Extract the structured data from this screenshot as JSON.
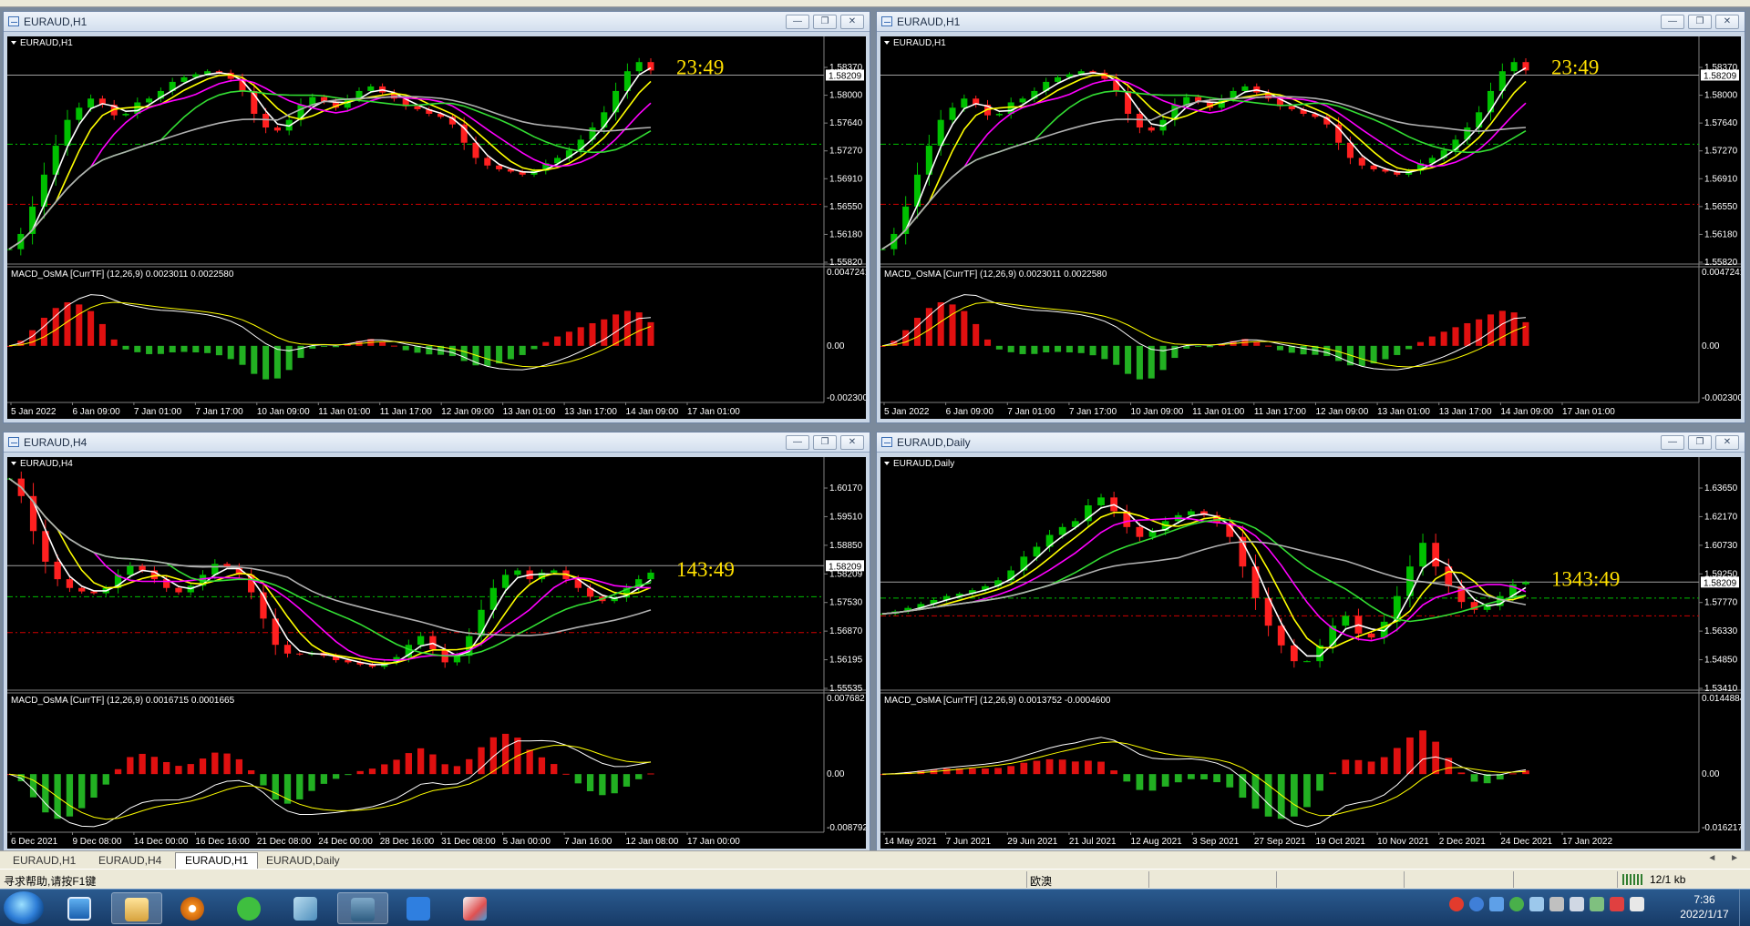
{
  "status": {
    "help_text": "寻求帮助,请按F1键",
    "profile": "欧澳",
    "traffic": "12/1 kb"
  },
  "tabs": [
    {
      "label": "EURAUD,H1",
      "active": false
    },
    {
      "label": "EURAUD,H4",
      "active": false
    },
    {
      "label": "EURAUD,H1",
      "active": true
    },
    {
      "label": "EURAUD,Daily",
      "active": false
    }
  ],
  "taskbar": {
    "time": "7:36",
    "date": "2022/1/17"
  },
  "icons": {
    "window_icon": "chart-window-icon",
    "minimize": "minimize-icon",
    "restore": "restore-icon",
    "close": "close-icon",
    "start": "windows-start-icon"
  },
  "colors": {
    "bull_candle": "#00c000",
    "bear_candle": "#ff2020",
    "ma_fast": "#ffffff",
    "ma_yellow": "#ffff00",
    "ma_magenta": "#ff00ff",
    "ma_green": "#33dd33",
    "ma_slow": "#b0b0b0",
    "countdown": "#ffe000",
    "hist_up": "#e01010",
    "hist_down": "#22b022",
    "dash_green": "#00c000",
    "dash_red": "#d00000"
  },
  "windows": [
    {
      "title": "EURAUD,H1",
      "label": "EURAUD,H1",
      "countdown": "23:49",
      "price_current": "1.58209",
      "price_ticks": [
        "1.58370",
        "1.58000",
        "1.57640",
        "1.57270",
        "1.56910",
        "1.56550",
        "1.56180",
        "1.55820"
      ],
      "macd_label": "MACD_OsMA [CurrTF] (12,26,9) 0.0023011 0.0022580",
      "macd_ticks": [
        "0.0047241",
        "0.00",
        "-0.002300"
      ],
      "time_ticks": [
        "5 Jan 2022",
        "6 Jan 09:00",
        "7 Jan 01:00",
        "7 Jan 17:00",
        "10 Jan 09:00",
        "11 Jan 01:00",
        "11 Jan 17:00",
        "12 Jan 09:00",
        "13 Jan 01:00",
        "13 Jan 17:00",
        "14 Jan 09:00",
        "17 Jan 01:00"
      ],
      "chart_data": {
        "type": "candlestick",
        "ylim": [
          1.5582,
          1.5855
        ],
        "close": [
          1.5592,
          1.5612,
          1.5648,
          1.569,
          1.5728,
          1.5762,
          1.5778,
          1.579,
          1.5782,
          1.5768,
          1.577,
          1.5785,
          1.579,
          1.58,
          1.5812,
          1.5818,
          1.5822,
          1.5826,
          1.5824,
          1.5816,
          1.58,
          1.577,
          1.5752,
          1.5748,
          1.5762,
          1.5782,
          1.5792,
          1.5786,
          1.5778,
          1.579,
          1.58,
          1.5806,
          1.5798,
          1.579,
          1.578,
          1.5776,
          1.577,
          1.5766,
          1.5756,
          1.5732,
          1.5712,
          1.5702,
          1.5697,
          1.5694,
          1.569,
          1.5695,
          1.5705,
          1.5712,
          1.5722,
          1.5736,
          1.5752,
          1.5772,
          1.58,
          1.5826,
          1.5838,
          1.5827
        ],
        "ma_series": [
          {
            "color_key": "ma_fast",
            "period": 3
          },
          {
            "color_key": "ma_yellow",
            "period": 5
          },
          {
            "color_key": "ma_magenta",
            "period": 8
          },
          {
            "color_key": "ma_green",
            "period": 14
          },
          {
            "color_key": "ma_slow",
            "period": 24
          }
        ],
        "hlines": [
          {
            "value": 1.58209,
            "color": "#a0a0a0",
            "style": "solid"
          },
          {
            "value": 1.573,
            "color_key": "dash_green",
            "style": "dash"
          },
          {
            "value": 1.5651,
            "color_key": "dash_red",
            "style": "dash"
          }
        ],
        "macd_range": [
          -0.0023,
          0.0047241
        ]
      }
    },
    {
      "title": "EURAUD,H1",
      "label": "EURAUD,H1",
      "countdown": "23:49",
      "price_current": "1.58209",
      "price_ticks": [
        "1.58370",
        "1.58000",
        "1.57640",
        "1.57270",
        "1.56910",
        "1.56550",
        "1.56180",
        "1.55820"
      ],
      "macd_label": "MACD_OsMA [CurrTF] (12,26,9) 0.0023011 0.0022580",
      "macd_ticks": [
        "0.0047241",
        "0.00",
        "-0.002300"
      ],
      "time_ticks": [
        "5 Jan 2022",
        "6 Jan 09:00",
        "7 Jan 01:00",
        "7 Jan 17:00",
        "10 Jan 09:00",
        "11 Jan 01:00",
        "11 Jan 17:00",
        "12 Jan 09:00",
        "13 Jan 01:00",
        "13 Jan 17:00",
        "14 Jan 09:00",
        "17 Jan 01:00"
      ],
      "chart_data": {
        "type": "candlestick",
        "ylim": [
          1.5582,
          1.5855
        ],
        "close": [
          1.5592,
          1.5612,
          1.5648,
          1.569,
          1.5728,
          1.5762,
          1.5778,
          1.579,
          1.5782,
          1.5768,
          1.577,
          1.5785,
          1.579,
          1.58,
          1.5812,
          1.5818,
          1.5822,
          1.5826,
          1.5824,
          1.5816,
          1.58,
          1.577,
          1.5752,
          1.5748,
          1.5762,
          1.5782,
          1.5792,
          1.5786,
          1.5778,
          1.579,
          1.58,
          1.5806,
          1.5798,
          1.579,
          1.578,
          1.5776,
          1.577,
          1.5766,
          1.5756,
          1.5732,
          1.5712,
          1.5702,
          1.5697,
          1.5694,
          1.569,
          1.5695,
          1.5705,
          1.5712,
          1.5722,
          1.5736,
          1.5752,
          1.5772,
          1.58,
          1.5826,
          1.5838,
          1.5827
        ],
        "ma_series": [
          {
            "color_key": "ma_fast",
            "period": 3
          },
          {
            "color_key": "ma_yellow",
            "period": 5
          },
          {
            "color_key": "ma_magenta",
            "period": 8
          },
          {
            "color_key": "ma_green",
            "period": 14
          },
          {
            "color_key": "ma_slow",
            "period": 24
          }
        ],
        "hlines": [
          {
            "value": 1.58209,
            "color": "#a0a0a0",
            "style": "solid"
          },
          {
            "value": 1.573,
            "color_key": "dash_green",
            "style": "dash"
          },
          {
            "value": 1.5651,
            "color_key": "dash_red",
            "style": "dash"
          }
        ],
        "macd_range": [
          -0.0023,
          0.0047241
        ]
      }
    },
    {
      "title": "EURAUD,H4",
      "label": "EURAUD,H4",
      "countdown": "143:49",
      "price_current": "1.58209",
      "price_ticks": [
        "1.60170",
        "1.59510",
        "1.58850",
        "1.58209",
        "1.57530",
        "1.56870",
        "1.56195",
        "1.55535"
      ],
      "macd_label": "MACD_OsMA [CurrTF] (12,26,9) 0.0016715 0.0001665",
      "macd_ticks": [
        "0.007682",
        "0.00",
        "-0.008792"
      ],
      "time_ticks": [
        "6 Dec 2021",
        "9 Dec 08:00",
        "14 Dec 00:00",
        "16 Dec 16:00",
        "21 Dec 08:00",
        "24 Dec 00:00",
        "28 Dec 16:00",
        "31 Dec 08:00",
        "5 Jan 00:00",
        "7 Jan 16:00",
        "12 Jan 08:00",
        "17 Jan 00:00"
      ],
      "chart_data": {
        "type": "candlestick",
        "ylim": [
          1.5553,
          1.604
        ],
        "close": [
          1.602,
          1.598,
          1.59,
          1.583,
          1.579,
          1.577,
          1.5762,
          1.5758,
          1.577,
          1.58,
          1.582,
          1.581,
          1.579,
          1.577,
          1.576,
          1.5775,
          1.58,
          1.5825,
          1.5818,
          1.58,
          1.576,
          1.57,
          1.564,
          1.562,
          1.5618,
          1.5622,
          1.5615,
          1.5605,
          1.56,
          1.5595,
          1.559,
          1.56,
          1.5612,
          1.564,
          1.566,
          1.563,
          1.56,
          1.5615,
          1.566,
          1.572,
          1.577,
          1.58,
          1.581,
          1.579,
          1.5805,
          1.581,
          1.579,
          1.577,
          1.575,
          1.574,
          1.5748,
          1.577,
          1.579,
          1.5805
        ],
        "ma_series": [
          {
            "color_key": "ma_fast",
            "period": 3
          },
          {
            "color_key": "ma_yellow",
            "period": 5
          },
          {
            "color_key": "ma_magenta",
            "period": 8
          },
          {
            "color_key": "ma_green",
            "period": 14
          },
          {
            "color_key": "ma_slow",
            "period": 24
          }
        ],
        "hlines": [
          {
            "value": 1.58209,
            "color": "#a0a0a0",
            "style": "solid"
          },
          {
            "value": 1.575,
            "color_key": "dash_green",
            "style": "dash"
          },
          {
            "value": 1.5668,
            "color_key": "dash_red",
            "style": "dash"
          }
        ],
        "macd_range": [
          -0.008792,
          0.007682
        ]
      }
    },
    {
      "title": "EURAUD,Daily",
      "label": "EURAUD,Daily",
      "countdown": "1343:49",
      "price_current": "1.58209",
      "price_ticks": [
        "1.63650",
        "1.62170",
        "1.60730",
        "1.59250",
        "1.57770",
        "1.56330",
        "1.54850",
        "1.53410"
      ],
      "macd_label": "MACD_OsMA [CurrTF] (12,26,9) 0.0013752 -0.0004600",
      "macd_ticks": [
        "0.0144884",
        "0.00",
        "-0.016217"
      ],
      "time_ticks": [
        "14 May 2021",
        "7 Jun 2021",
        "29 Jun 2021",
        "21 Jul 2021",
        "12 Aug 2021",
        "3 Sep 2021",
        "27 Sep 2021",
        "19 Oct 2021",
        "10 Nov 2021",
        "2 Dec 2021",
        "24 Dec 2021",
        "17 Jan 2022"
      ],
      "chart_data": {
        "type": "candlestick",
        "ylim": [
          1.531,
          1.639
        ],
        "close": [
          1.566,
          1.5672,
          1.569,
          1.571,
          1.573,
          1.575,
          1.5762,
          1.578,
          1.58,
          1.583,
          1.588,
          1.595,
          1.6,
          1.606,
          1.61,
          1.613,
          1.621,
          1.625,
          1.618,
          1.61,
          1.605,
          1.608,
          1.613,
          1.616,
          1.618,
          1.616,
          1.612,
          1.605,
          1.59,
          1.574,
          1.56,
          1.55,
          1.542,
          1.542,
          1.55,
          1.56,
          1.565,
          1.556,
          1.554,
          1.562,
          1.575,
          1.59,
          1.602,
          1.59,
          1.58,
          1.572,
          1.568,
          1.57,
          1.575,
          1.581,
          1.582
        ],
        "ma_series": [
          {
            "color_key": "ma_fast",
            "period": 3
          },
          {
            "color_key": "ma_yellow",
            "period": 5
          },
          {
            "color_key": "ma_magenta",
            "period": 8
          },
          {
            "color_key": "ma_green",
            "period": 14
          },
          {
            "color_key": "ma_slow",
            "period": 24
          }
        ],
        "hlines": [
          {
            "value": 1.58209,
            "color": "#a0a0a0",
            "style": "solid"
          },
          {
            "value": 1.574,
            "color_key": "dash_green",
            "style": "dash"
          },
          {
            "value": 1.565,
            "color_key": "dash_red",
            "style": "dash"
          }
        ],
        "macd_range": [
          -0.016217,
          0.0144884
        ]
      }
    }
  ]
}
